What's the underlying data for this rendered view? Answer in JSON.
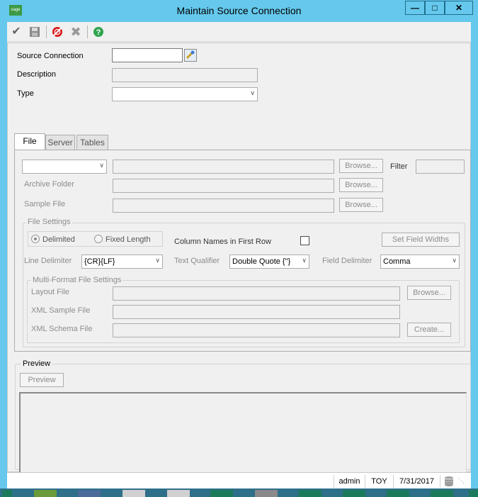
{
  "window": {
    "title": "Maintain Source Connection",
    "app_icon_text": "sage",
    "controls": [
      "minimize-icon",
      "maximize-icon",
      "close-icon"
    ]
  },
  "toolbar": {
    "icons": [
      "accept-check-icon",
      "save-disk-icon",
      "delete-icon",
      "cancel-x-icon",
      "help-icon"
    ]
  },
  "form": {
    "source_connection_label": "Source Connection",
    "source_connection_value": "",
    "description_label": "Description",
    "description_value": "",
    "type_label": "Type",
    "type_value": ""
  },
  "tabs": [
    {
      "label": "File",
      "active": true
    },
    {
      "label": "Server",
      "active": false
    },
    {
      "label": "Tables",
      "active": false
    }
  ],
  "file_tab": {
    "location_combo_value": "",
    "browse_label": "Browse...",
    "filter_label": "Filter",
    "archive_folder_label": "Archive Folder",
    "sample_file_label": "Sample File",
    "file_settings_title": "File Settings",
    "delimited_label": "Delimited",
    "fixed_length_label": "Fixed Length",
    "delimited_selected": true,
    "column_names_label": "Column Names in First Row",
    "column_names_checked": false,
    "set_field_widths_label": "Set Field Widths",
    "line_delimiter_label": "Line Delimiter",
    "line_delimiter_value": "{CR}{LF}",
    "text_qualifier_label": "Text Qualifier",
    "text_qualifier_value": "Double Quote {\"}",
    "field_delimiter_label": "Field Delimiter",
    "field_delimiter_value": "Comma",
    "multi_format_title": "Multi-Format File Settings",
    "layout_file_label": "Layout File",
    "xml_sample_file_label": "XML Sample File",
    "xml_schema_file_label": "XML Schema File",
    "create_label": "Create..."
  },
  "preview": {
    "section_title": "Preview",
    "button_label": "Preview"
  },
  "statusbar": {
    "user": "admin",
    "company": "TOY",
    "date": "7/31/2017"
  },
  "colors": {
    "titlebar": "#65c8ec",
    "window_bg": "#f0f0f0",
    "disabled_text": "#8c8c8c"
  }
}
